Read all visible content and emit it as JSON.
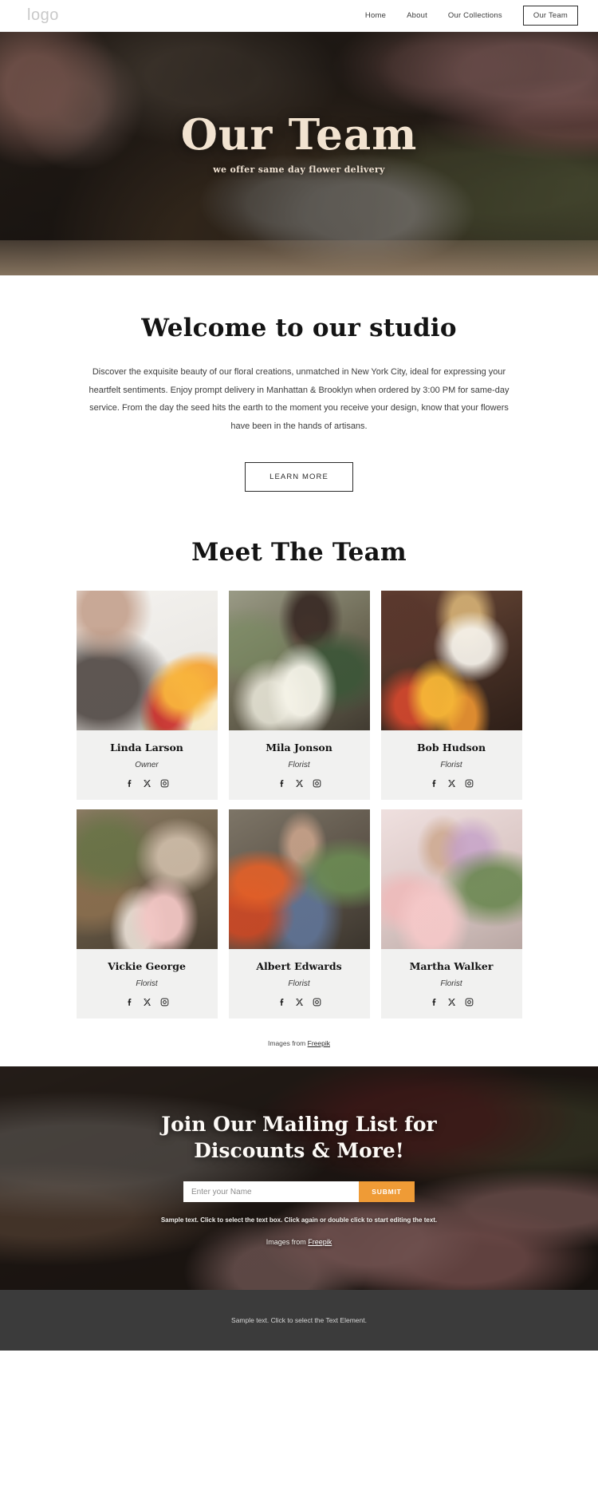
{
  "header": {
    "logo": "logo",
    "nav": [
      {
        "label": "Home",
        "active": false
      },
      {
        "label": "About",
        "active": false
      },
      {
        "label": "Our Collections",
        "active": false
      },
      {
        "label": "Our Team",
        "active": true
      }
    ]
  },
  "hero": {
    "title": "Our Team",
    "subtitle": "we offer same day flower delivery"
  },
  "welcome": {
    "title": "Welcome to our studio",
    "paragraph": "Discover the exquisite beauty of our floral creations, unmatched in New York City, ideal for expressing your heartfelt sentiments. Enjoy prompt delivery in Manhattan & Brooklyn when ordered by 3:00 PM for same-day service.  From the day the seed hits the earth to the moment you receive your design, know that your flowers have been in the hands of artisans.",
    "button": "LEARN MORE"
  },
  "team": {
    "title": "Meet The Team",
    "members": [
      {
        "name": "Linda Larson",
        "role": "Owner"
      },
      {
        "name": "Mila Jonson",
        "role": "Florist"
      },
      {
        "name": "Bob Hudson",
        "role": "Florist"
      },
      {
        "name": "Vickie George",
        "role": "Florist"
      },
      {
        "name": "Albert Edwards",
        "role": "Florist"
      },
      {
        "name": "Martha Walker",
        "role": "Florist"
      }
    ],
    "social_icons": [
      "facebook-icon",
      "x-twitter-icon",
      "instagram-icon"
    ],
    "credits_prefix": "Images from ",
    "credits_link": "Freepik"
  },
  "mailing": {
    "title_line1": "Join Our Mailing List for",
    "title_line2": "Discounts & More!",
    "input_placeholder": "Enter your Name",
    "input_value": "",
    "submit_label": "SUBMIT",
    "note": "Sample text. Click to select the text box. Click again or double click to start editing the text.",
    "credits_prefix": "Images from ",
    "credits_link": "Freepik",
    "accent_color": "#ef9b36"
  },
  "footer": {
    "text": "Sample text. Click to select the Text Element."
  }
}
